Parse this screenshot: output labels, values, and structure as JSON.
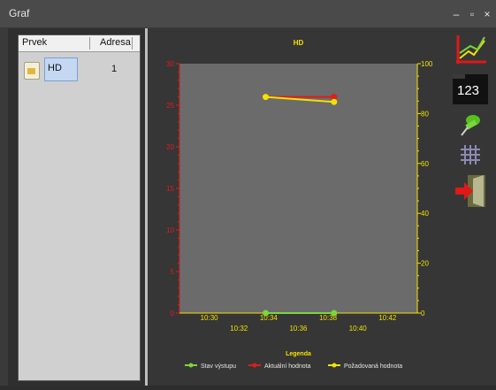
{
  "window": {
    "title": "Graf",
    "minimize": "–",
    "maximize": "▫",
    "close": "×"
  },
  "list": {
    "columns": [
      "Prvek",
      "Adresa"
    ],
    "rows": [
      {
        "name": "HD",
        "address": "1"
      }
    ]
  },
  "toolbar": {
    "counter_label": "123"
  },
  "chart_data": {
    "type": "line",
    "title": "HD",
    "x_ticks_top": [
      "10:30",
      "10:34",
      "10:38",
      "10:42"
    ],
    "x_ticks_bottom": [
      "10:32",
      "10:36",
      "10:40"
    ],
    "y_left": {
      "range": [
        0,
        30
      ],
      "ticks": [
        0,
        5,
        10,
        15,
        20,
        25,
        30
      ],
      "color": "#e11b1b"
    },
    "y_right": {
      "range": [
        0,
        100
      ],
      "ticks": [
        0,
        20,
        40,
        60,
        80,
        100
      ],
      "color": "#f2e200"
    },
    "series": [
      {
        "name": "Stav výstupu",
        "color": "#7ad63a",
        "axis": "left",
        "points": [
          [
            "10:33.8",
            0
          ],
          [
            "10:38.4",
            0
          ]
        ]
      },
      {
        "name": "Aktuální hodnota",
        "color": "#e11b1b",
        "axis": "left",
        "points": [
          [
            "10:33.8",
            26
          ],
          [
            "10:38.4",
            26
          ]
        ]
      },
      {
        "name": "Požadovaná hodnota",
        "color": "#f2e200",
        "axis": "left",
        "points": [
          [
            "10:33.8",
            26
          ],
          [
            "10:38.4",
            25.4
          ]
        ]
      }
    ],
    "legend": {
      "title": "Legenda",
      "position": "bottom"
    },
    "grid": false
  }
}
